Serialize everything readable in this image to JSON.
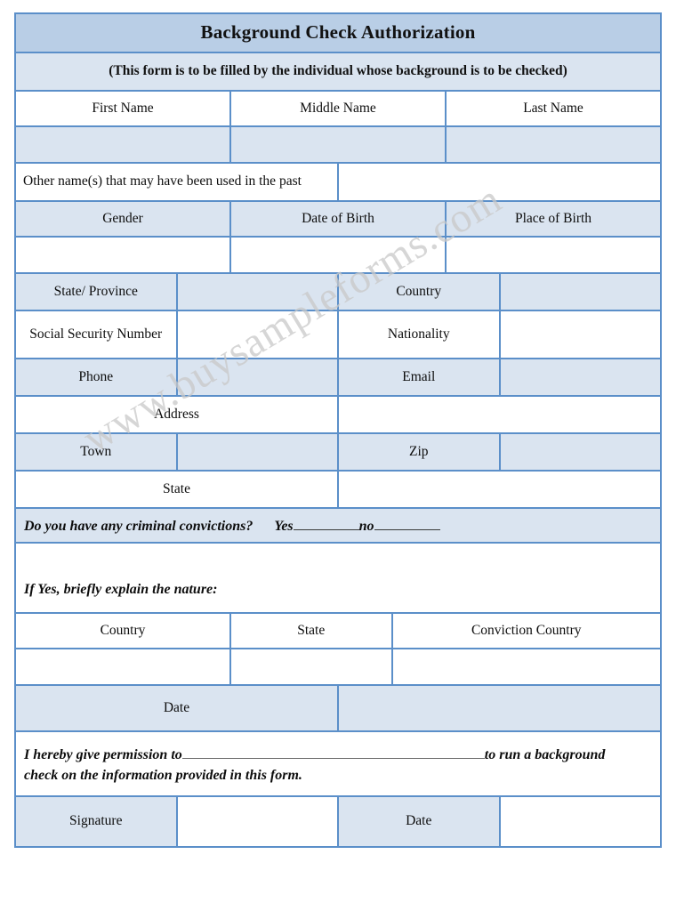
{
  "document": {
    "title": "Background Check Authorization",
    "subtitle": "(This form is to be filled by the individual whose background is to be checked)",
    "watermark": "www.buysampleforms.com"
  },
  "colors": {
    "border": "#5b8fc9",
    "title_fill": "#b9cee6",
    "row_fill": "#dae4f0",
    "white_fill": "#ffffff",
    "watermark": "#c9c9c9"
  },
  "name_row": {
    "first_name": "First Name",
    "middle_name": "Middle Name",
    "last_name": "Last Name",
    "first_name_value": "",
    "middle_name_value": "",
    "last_name_value": ""
  },
  "other_names": {
    "label": "Other name(s) that may have been used in the past",
    "value": ""
  },
  "birth_row": {
    "gender": "Gender",
    "date_of_birth": "Date of Birth",
    "place_of_birth": "Place of Birth",
    "gender_value": "",
    "date_of_birth_value": "",
    "place_of_birth_value": ""
  },
  "details": {
    "state_province": "State/ Province",
    "state_province_value": "",
    "country": "Country",
    "country_value": "",
    "ssn": "Social Security Number",
    "ssn_value": "",
    "nationality": "Nationality",
    "nationality_value": "",
    "phone": "Phone",
    "phone_value": "",
    "email": "Email",
    "email_value": "",
    "address": "Address",
    "address_value": "",
    "town": "Town",
    "town_value": "",
    "zip": "Zip",
    "zip_value": "",
    "state": "State",
    "state_value": ""
  },
  "convictions": {
    "question": "Do you have any criminal convictions?",
    "yes_label": "Yes",
    "no_label": "no",
    "yes_value": "",
    "no_value": "",
    "explain_label": "If Yes, briefly explain the nature:",
    "explain_value": ""
  },
  "conviction_table": {
    "headers": [
      "Country",
      "State",
      "Conviction Country"
    ],
    "values": [
      "",
      "",
      ""
    ]
  },
  "conviction_date": {
    "label": "Date",
    "value": ""
  },
  "permission": {
    "text_before": "I hereby give permission to",
    "company_value": "",
    "text_after": "to run a background",
    "text_line2": "check on the information provided in this form."
  },
  "signature_row": {
    "signature_label": "Signature",
    "signature_value": "",
    "date_label": "Date",
    "date_value": ""
  }
}
